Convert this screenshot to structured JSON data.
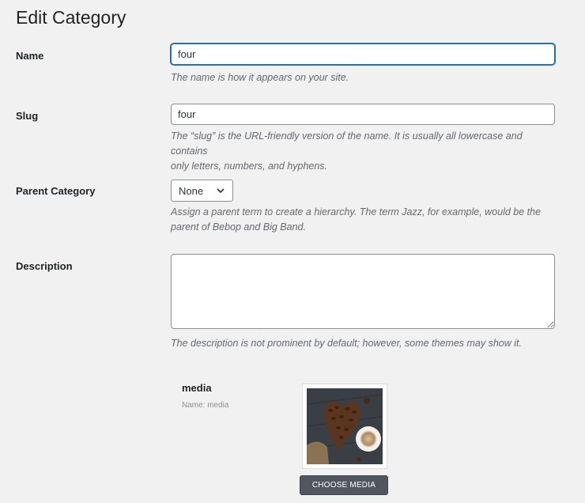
{
  "page": {
    "title": "Edit Category"
  },
  "fields": {
    "name": {
      "label": "Name",
      "value": "four",
      "help": "The name is how it appears on your site."
    },
    "slug": {
      "label": "Slug",
      "value": "four",
      "help_line1": "The “slug” is the URL-friendly version of the name. It is usually all lowercase and contains",
      "help_line2": "only letters, numbers, and hyphens."
    },
    "parent": {
      "label": "Parent Category",
      "selected": "None",
      "help_line1": "Assign a parent term to create a hierarchy. The term Jazz, for example, would be the",
      "help_line2": "parent of Bebop and Big Band."
    },
    "description": {
      "label": "Description",
      "value": "",
      "help": "The description is not prominent by default; however, some themes may show it."
    }
  },
  "media": {
    "title": "media",
    "subtitle": "Name: media",
    "thumbnail_icon": "coffee-beans-image",
    "choose_label": "CHOOSE MEDIA"
  },
  "colors": {
    "focus": "#2271b1",
    "button": "#50575e",
    "background": "#f1f1f1"
  }
}
